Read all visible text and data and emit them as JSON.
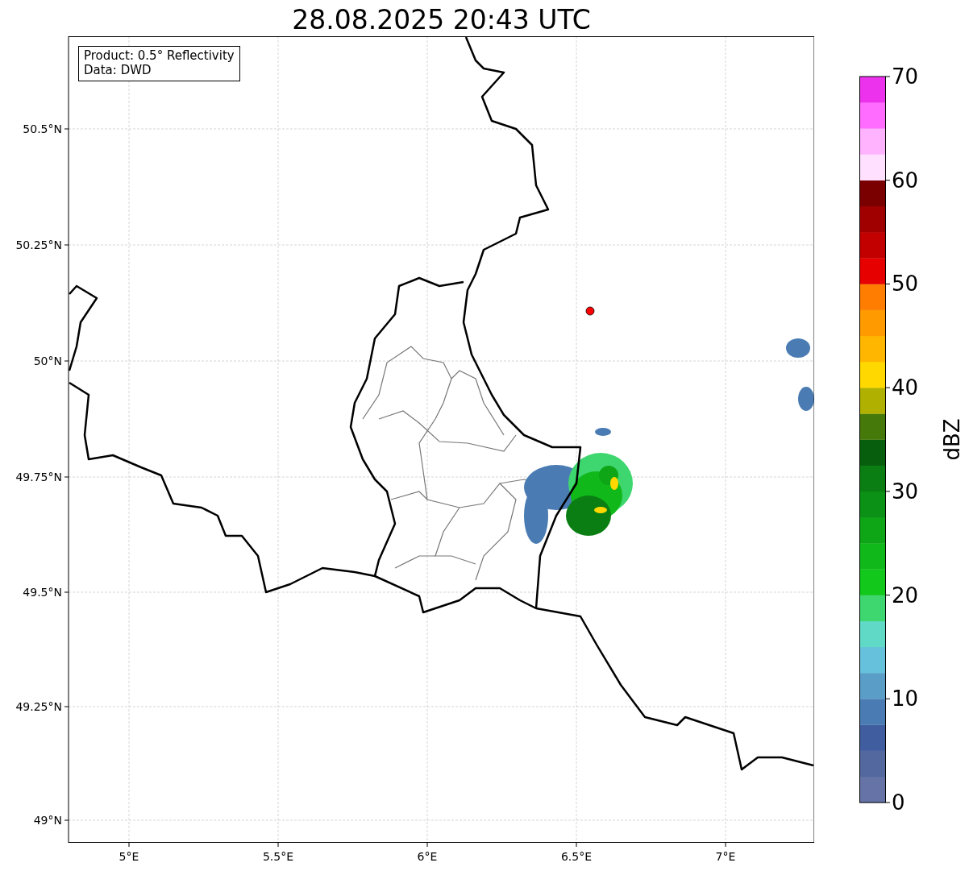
{
  "title": "28.08.2025 20:43 UTC",
  "info_box": {
    "lines": [
      "Product: 0.5° Reflectivity",
      "Data: DWD"
    ]
  },
  "map": {
    "x_ticks": [
      "5°E",
      "5.5°E",
      "6°E",
      "6.5°E",
      "7°E"
    ],
    "y_ticks": [
      "50.5°N",
      "50.25°N",
      "50°N",
      "49.75°N",
      "49.5°N",
      "49.25°N",
      "49°N"
    ]
  },
  "colorbar": {
    "label": "dBZ",
    "ticks": [
      "70",
      "60",
      "50",
      "40",
      "30",
      "20",
      "10",
      "0"
    ],
    "segments": [
      {
        "color": "#6573a6"
      },
      {
        "color": "#52689f"
      },
      {
        "color": "#405da0"
      },
      {
        "color": "#4a7cb3"
      },
      {
        "color": "#5a9dc6"
      },
      {
        "color": "#66c1dc"
      },
      {
        "color": "#60d9c6"
      },
      {
        "color": "#3ed66e"
      },
      {
        "color": "#11c81b"
      },
      {
        "color": "#10b819"
      },
      {
        "color": "#0ea516"
      },
      {
        "color": "#0b9115"
      },
      {
        "color": "#0a7e12"
      },
      {
        "color": "#075e0d"
      },
      {
        "color": "#457a0b"
      },
      {
        "color": "#b0b000"
      },
      {
        "color": "#ffd800"
      },
      {
        "color": "#ffb600"
      },
      {
        "color": "#ff9a00"
      },
      {
        "color": "#ff7d00"
      },
      {
        "color": "#e60000"
      },
      {
        "color": "#c20000"
      },
      {
        "color": "#a10000"
      },
      {
        "color": "#7a0000"
      },
      {
        "color": "#ffe0ff"
      },
      {
        "color": "#ffb3ff"
      },
      {
        "color": "#ff6cff"
      },
      {
        "color": "#ec32ec"
      }
    ]
  }
}
